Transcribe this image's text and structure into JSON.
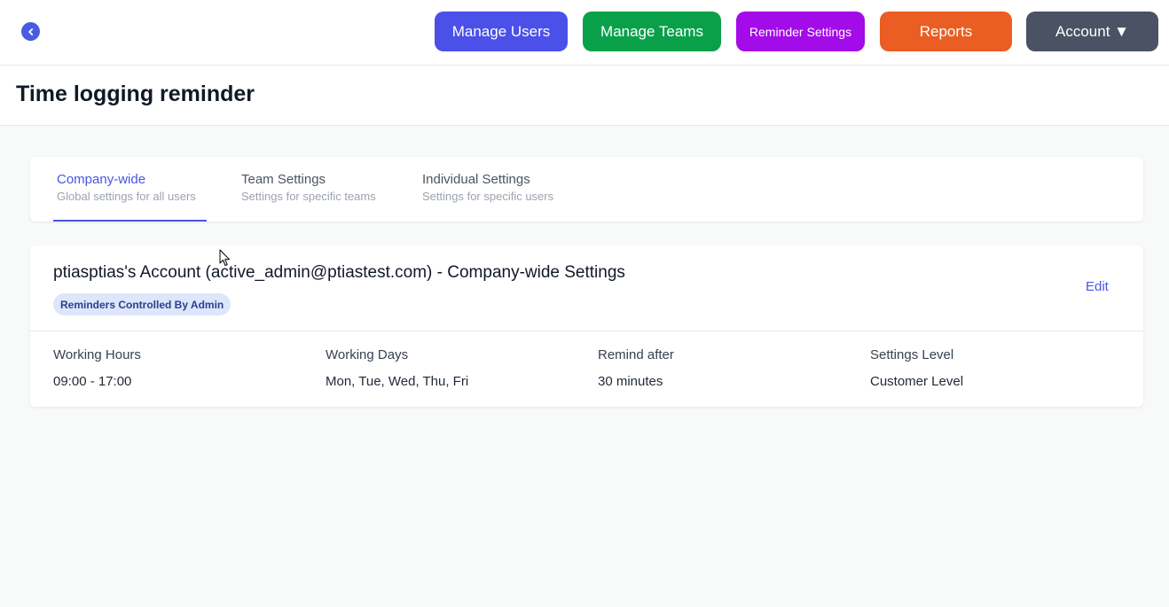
{
  "topbar": {
    "back_icon": "chevron-left-icon",
    "buttons": {
      "manage_users": "Manage Users",
      "manage_teams": "Manage Teams",
      "reminder_settings": "Reminder Settings",
      "reports": "Reports",
      "account": "Account ▼"
    },
    "colors": {
      "manage_users": "#4a50e8",
      "manage_teams": "#0aa04a",
      "reminder_settings": "#a30be8",
      "reports": "#ea5e23",
      "account": "#4b5263"
    }
  },
  "page": {
    "title": "Time logging reminder"
  },
  "tabs": [
    {
      "title": "Company-wide",
      "subtitle": "Global settings for all users",
      "active": true
    },
    {
      "title": "Team Settings",
      "subtitle": "Settings for specific teams",
      "active": false
    },
    {
      "title": "Individual Settings",
      "subtitle": "Settings for specific users",
      "active": false
    }
  ],
  "settings_card": {
    "title": "ptiasptias's Account (active_admin@ptiastest.com) - Company-wide Settings",
    "badge": "Reminders Controlled By Admin",
    "edit_label": "Edit",
    "fields": [
      {
        "label": "Working Hours",
        "value": "09:00 - 17:00"
      },
      {
        "label": "Working Days",
        "value": "Mon, Tue, Wed, Thu, Fri"
      },
      {
        "label": "Remind after",
        "value": "30 minutes"
      },
      {
        "label": "Settings Level",
        "value": "Customer Level"
      }
    ]
  },
  "accent_color": "#4a55e0"
}
